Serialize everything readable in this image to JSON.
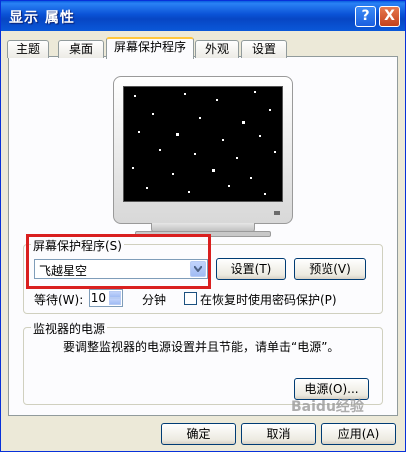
{
  "window": {
    "title": "显示 属性"
  },
  "titlebar": {
    "help_glyph": "?",
    "close_glyph": "X"
  },
  "tabs": [
    {
      "label": "主题",
      "active": false
    },
    {
      "label": "桌面",
      "active": false
    },
    {
      "label": "屏幕保护程序",
      "active": true
    },
    {
      "label": "外观",
      "active": false
    },
    {
      "label": "设置",
      "active": false
    }
  ],
  "screensaver": {
    "group_label": "屏幕保护程序(S)",
    "selected": "飞越星空",
    "settings_button": "设置(T)",
    "preview_button": "预览(V)",
    "wait_label": "等待(W):",
    "wait_value": "10",
    "wait_unit": "分钟",
    "password_checkbox_label": "在恢复时使用密码保护(P)",
    "password_checked": false
  },
  "power": {
    "group_label": "监视器的电源",
    "description": "要调整监视器的电源设置并且节能，请单击“电源”。",
    "power_button": "电源(O)..."
  },
  "footer": {
    "ok": "确定",
    "cancel": "取消",
    "apply": "应用(A)"
  },
  "watermark": "Baidu经验"
}
